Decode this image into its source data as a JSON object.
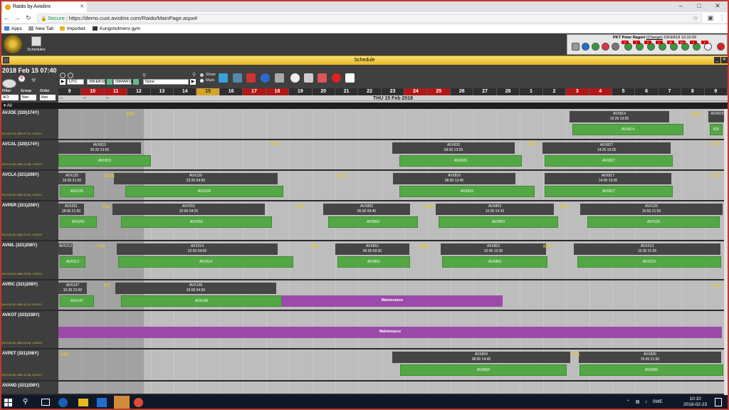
{
  "browser": {
    "tab_title": "Raido by Aviolinx",
    "url_secure_label": "Secure",
    "url": "https://demo.cust.aviolinx.com/Raido/MainPage.aspx#",
    "bookmarks": [
      "Apps",
      "New Tab",
      "Imported",
      "Kungsholmens gym"
    ]
  },
  "app": {
    "toolbar_label": "Schedules",
    "user_line": "PKT Peter Ragert",
    "change_label": "(Change)",
    "user_date": "23FEB18 10:10:09",
    "badges": [
      "27",
      "0",
      "0",
      "0",
      "30",
      "311",
      "0",
      "0"
    ]
  },
  "schedule": {
    "window_title": "Schedule",
    "current_datetime": "2018 Feb 15 07:40",
    "timezone": "UTC",
    "from_date": "09FEB18",
    "to_date": "09MAR18",
    "none_select": "None",
    "show_label": "Show",
    "mark_label": "Mark",
    "filter_label": "Filter",
    "group_label": "Group",
    "order_label": "Order",
    "filter_value": "ACt",
    "group_value": "Non",
    "order_value": "Non",
    "date_banner": "THU 15 Feb 2018",
    "all_label": "All",
    "days": [
      "9",
      "10",
      "11",
      "12",
      "13",
      "14",
      "15",
      "16",
      "17",
      "18",
      "19",
      "20",
      "21",
      "22",
      "23",
      "24",
      "25",
      "26",
      "27",
      "28",
      "1",
      "2",
      "3",
      "4",
      "5",
      "6",
      "7",
      "8",
      "9"
    ],
    "day_colors": [
      "dark",
      "red",
      "red",
      "dark",
      "dark",
      "dark",
      "yellow",
      "dark",
      "red",
      "red",
      "dark",
      "dark",
      "dark",
      "dark",
      "dark",
      "red",
      "red",
      "dark",
      "dark",
      "dark",
      "dark",
      "dark",
      "red",
      "red",
      "dark",
      "dark",
      "dark",
      "dark",
      "dark"
    ],
    "tick_labels": [
      "21",
      "22",
      "23",
      "",
      "",
      "",
      "",
      "",
      "",
      "",
      "",
      "",
      "",
      "",
      "",
      "",
      "",
      "",
      "",
      "",
      "",
      "",
      "",
      "",
      "",
      "",
      "",
      "",
      ""
    ]
  },
  "aircraft": [
    {
      "reg": "AVJOE (320)174Y)",
      "sub": "BLH:87:04, ABH:07:22, LEG5:2",
      "flights": [
        {
          "n": "AVX814",
          "t": "15:25  19:05"
        },
        {
          "n": "AVX815",
          "t": ""
        }
      ],
      "greens": [
        "AVX814",
        "815"
      ],
      "stations": [
        "KEF",
        "LGW"
      ]
    },
    {
      "reg": "AVCAL (320)174Y)",
      "sub": "BLH:13:55, ABH:12:38, LEG5:2",
      "flights": [
        {
          "n": "AVX815",
          "t": "20:25  23:55"
        },
        {
          "n": "AVX826",
          "t": "09:00  13:25"
        },
        {
          "n": "AVX827",
          "t": "14:25  19:25"
        }
      ],
      "greens": [
        "AVX815",
        "AVX826",
        "AVX827"
      ],
      "stations": [
        "KEF",
        "BCN",
        "KEF"
      ]
    },
    {
      "reg": "AVCLA (321)208Y)",
      "sub": "BLH:22:05, ABH:22:42, LEG5:4",
      "flights": [
        {
          "n": "AVX125",
          "t": "15:50  21:50"
        },
        {
          "n": "AVX126",
          "t": "23:20  04:50"
        },
        {
          "n": "AVX816",
          "t": "08:00  13:45"
        },
        {
          "n": "AVX817",
          "t": "14:30  19:35"
        }
      ],
      "greens": [
        "AVX125",
        "AVX126",
        "AVX816",
        "AVX817"
      ],
      "stations": [
        "BOS",
        "KEF",
        "KEF"
      ]
    },
    {
      "reg": "AVPER (321)208Y)",
      "sub": "BLH:24:46, ABH:23:41, LEG5:5",
      "flights": [
        {
          "n": "AVX251",
          "t": "18:00  21:50"
        },
        {
          "n": "AVX252",
          "t": "22:55  04:25"
        },
        {
          "n": "AVX802",
          "t": "06:30  09:40"
        },
        {
          "n": "AVX803",
          "t": "10:35  14:10"
        },
        {
          "n": "AVX125",
          "t": "15:50  21:50"
        }
      ],
      "greens": [
        "AVX251",
        "AVX252",
        "AVX802",
        "AVX803",
        "AVX125"
      ],
      "stations": [
        "YUL",
        "KEF",
        "CDG",
        "KEF"
      ]
    },
    {
      "reg": "AVNIL (321)208Y)",
      "sub": "BLH:24:04, ABH:23:06, LEG5:5",
      "flights": [
        {
          "n": "AVX213",
          "t": ""
        },
        {
          "n": "AVX214",
          "t": "22:55  04:50"
        },
        {
          "n": "AVX852",
          "t": "06:55  09:30"
        },
        {
          "n": "AVX853",
          "t": "10:45  13:35"
        },
        {
          "n": "AVX213",
          "t": "15:30  21:25"
        }
      ],
      "greens": [
        "AVX213",
        "AVX214",
        "AVX852",
        "AVX853",
        "AVX213"
      ],
      "stations": [
        "YYZ",
        "KEF",
        "AMS",
        "KEF"
      ]
    },
    {
      "reg": "AVRIC (321)208Y)",
      "sub": "BLH:12:52, ABH:12:11, LEG5:2",
      "flights": [
        {
          "n": "AVX147",
          "t": "15:25  22:00"
        },
        {
          "n": "AVX148",
          "t": "23:00  04:50"
        }
      ],
      "greens": [
        "AVX147",
        "AVX148"
      ],
      "maintenance": "Maintenance",
      "stations": [
        "PIT",
        "KEF"
      ]
    },
    {
      "reg": "AVKOT (333)338Y)",
      "sub": "BLH:00:00, ABH:00:00, LEG5:0",
      "flights": [],
      "greens": [],
      "maintenance": "Maintenance",
      "stations": []
    },
    {
      "reg": "AVPET (321)208Y)",
      "sub": "BLH:22:06, ABH:11:46, LEG5:2",
      "flights": [
        {
          "n": "AVX834",
          "t": "08:00  14:45"
        },
        {
          "n": "AVX835",
          "t": "15:45  21:50"
        }
      ],
      "greens": [
        "AVX834",
        "AVX835"
      ],
      "stations": [
        "KEF",
        "TFS"
      ]
    },
    {
      "reg": "AVAND (321)208Y)",
      "sub": "",
      "flights": [],
      "greens": [],
      "stations": []
    }
  ],
  "taskbar": {
    "time": "10:10",
    "date": "2018-02-23",
    "lang": "SWE"
  }
}
